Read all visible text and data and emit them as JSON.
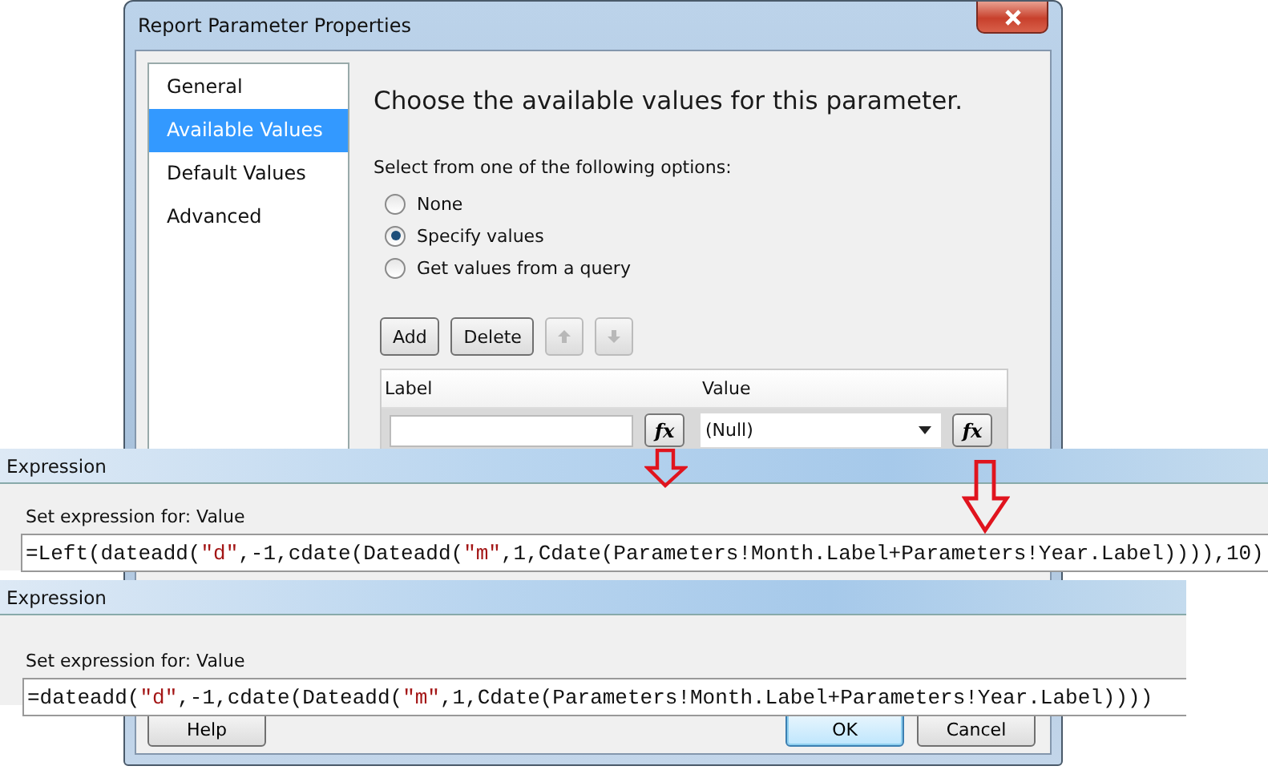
{
  "dialog": {
    "title": "Report Parameter Properties"
  },
  "sidebar": [
    {
      "label": "General",
      "selected": false
    },
    {
      "label": "Available Values",
      "selected": true
    },
    {
      "label": "Default Values",
      "selected": false
    },
    {
      "label": "Advanced",
      "selected": false
    }
  ],
  "heading": "Choose the available values for this parameter.",
  "options_label": "Select from one of the following options:",
  "options": [
    {
      "label": "None",
      "selected": false
    },
    {
      "label": "Specify values",
      "selected": true
    },
    {
      "label": "Get values from a query",
      "selected": false
    }
  ],
  "toolbar": [
    {
      "kind": "text",
      "label": "Add",
      "disabled": false
    },
    {
      "kind": "text",
      "label": "Delete",
      "disabled": false
    },
    {
      "kind": "up",
      "disabled": true
    },
    {
      "kind": "down",
      "disabled": true
    }
  ],
  "grid": {
    "columns": [
      "Label",
      "Value"
    ],
    "value": "(Null)",
    "expression_buttons": [
      "fx",
      "fx"
    ]
  },
  "expressions": [
    {
      "title": "Expression",
      "prompt": "Set expression for: Value",
      "code": [
        {
          "kind": "plain",
          "text": "=Left(dateadd("
        },
        {
          "kind": "string",
          "text": "\"d\""
        },
        {
          "kind": "plain",
          "text": ",-1,cdate(Dateadd("
        },
        {
          "kind": "string",
          "text": "\"m\""
        },
        {
          "kind": "plain",
          "text": ",1,Cdate(Parameters!Month.Label+Parameters!Year.Label)))),10)"
        }
      ]
    },
    {
      "title": "Expression",
      "prompt": "Set expression for: Value",
      "code": [
        {
          "kind": "plain",
          "text": "=dateadd("
        },
        {
          "kind": "string",
          "text": "\"d\""
        },
        {
          "kind": "plain",
          "text": ",-1,cdate(Dateadd("
        },
        {
          "kind": "string",
          "text": "\"m\""
        },
        {
          "kind": "plain",
          "text": ",1,Cdate(Parameters!Month.Label+Parameters!Year.Label))))"
        }
      ]
    }
  ],
  "buttons": [
    {
      "label": "Help",
      "default": false
    },
    {
      "label": "OK",
      "default": true
    },
    {
      "label": "Cancel",
      "default": false
    }
  ]
}
